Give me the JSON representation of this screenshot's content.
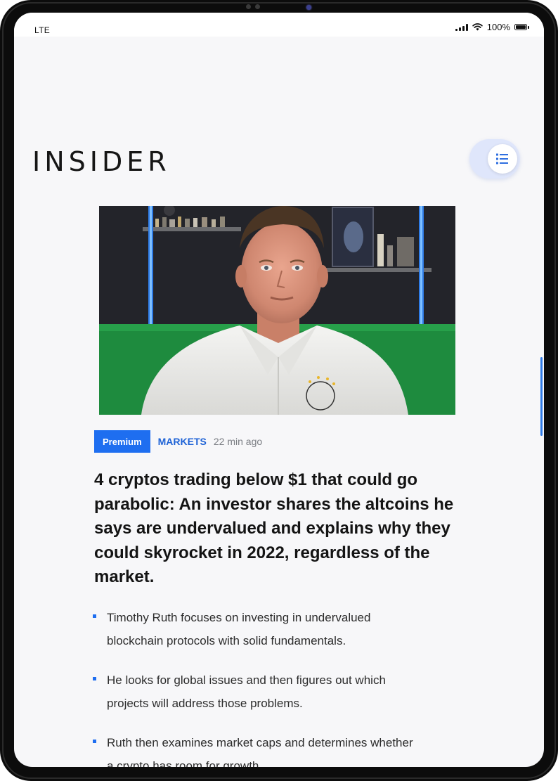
{
  "status_bar": {
    "carrier": "LTE",
    "battery": "100%"
  },
  "header": {
    "logo_text": "INSIDER",
    "menu_icon": "list-icon"
  },
  "article": {
    "badge": "Premium",
    "section": "MARKETS",
    "timestamp": "22 min ago",
    "headline": "4 cryptos trading below $1 that could go parabolic: An investor shares the altcoins he says are undervalued and explains why they could skyrocket in 2022, regardless of the market.",
    "bullets": [
      "Timothy Ruth focuses on investing in undervalued blockchain protocols with solid fundamentals.",
      "He looks for global issues and then figures out which projects will address those problems.",
      "Ruth then examines market caps and determines whether a crypto has room for growth."
    ]
  },
  "colors": {
    "accent": "#1e6ef0",
    "section_link": "#1f63d6",
    "headline": "#141414",
    "timestamp": "#7a7d83",
    "menu_toggle_bg": "#dfe6fb"
  }
}
